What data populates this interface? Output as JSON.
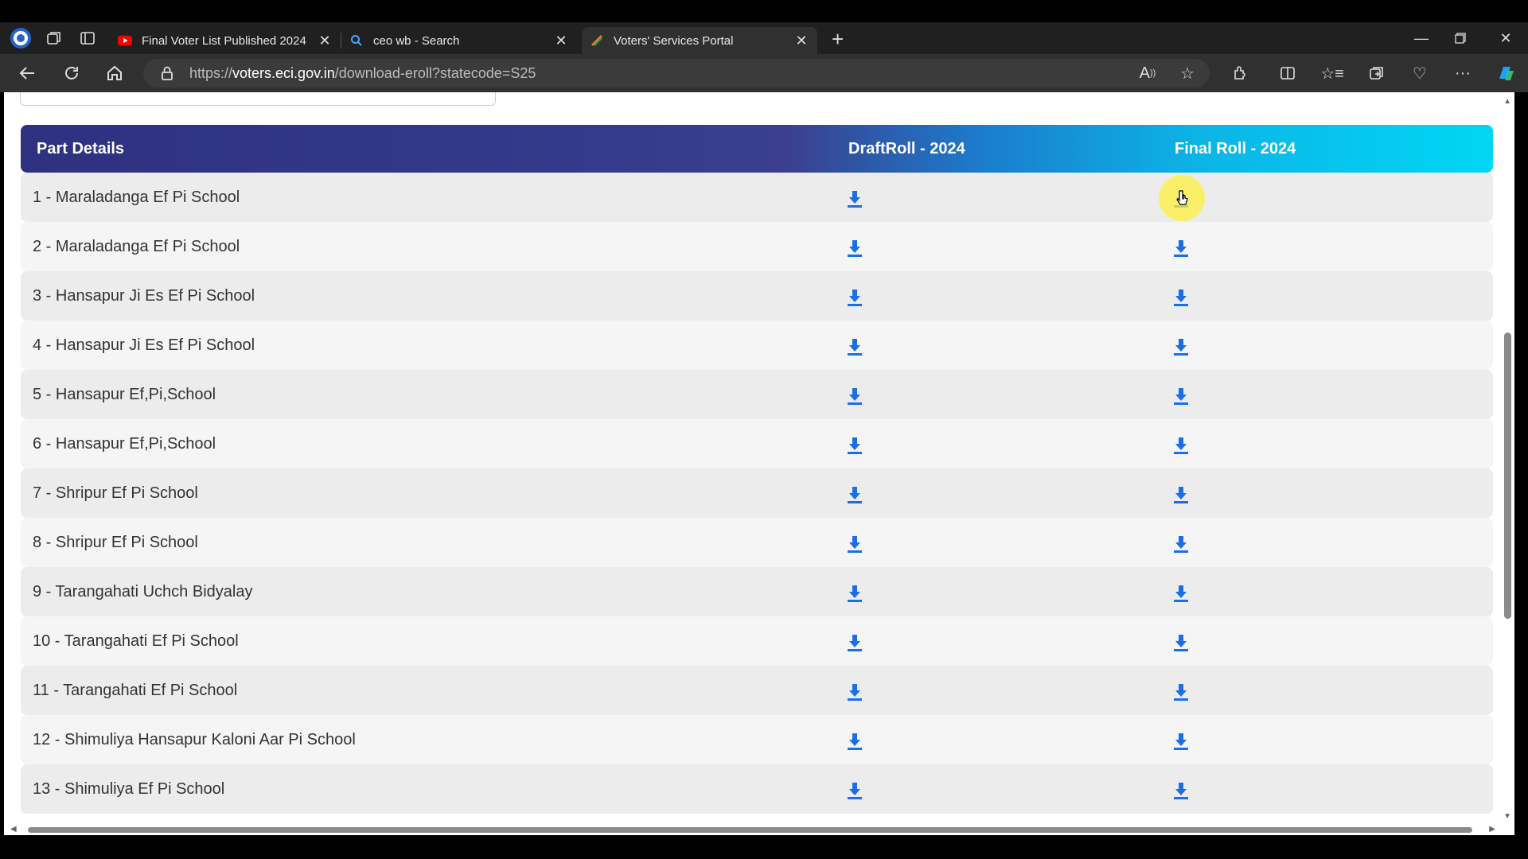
{
  "browser": {
    "tabs": [
      {
        "title": "Final Voter List Published 2024 ||",
        "favicon": "youtube-icon",
        "active": false
      },
      {
        "title": "ceo wb - Search",
        "favicon": "search-icon",
        "active": false
      },
      {
        "title": "Voters' Services Portal",
        "favicon": "eci-icon",
        "active": true
      }
    ],
    "url_prefix": "https://",
    "url_host": "voters.eci.gov.in",
    "url_path": "/download-eroll?statecode=S25"
  },
  "table": {
    "headers": {
      "part": "Part Details",
      "draft": "DraftRoll - 2024",
      "final": "Final Roll - 2024"
    },
    "rows": [
      "1 - Maraladanga Ef Pi School",
      "2 - Maraladanga Ef Pi School",
      "3 - Hansapur Ji Es Ef Pi School",
      "4 - Hansapur Ji Es Ef Pi School",
      "5 - Hansapur Ef,Pi,School",
      "6 - Hansapur Ef,Pi,School",
      "7 - Shripur Ef Pi School",
      "8 - Shripur Ef Pi School",
      "9 - Tarangahati Uchch Bidyalay",
      "10 - Tarangahati Ef Pi School",
      "11 - Tarangahati Ef Pi School",
      "12 - Shimuliya Hansapur Kaloni Aar Pi School",
      "13 - Shimuliya Ef Pi School"
    ]
  },
  "colors": {
    "download_icon": "#1a6ee8",
    "header_start": "#2e3180",
    "header_end": "#00d7f4"
  }
}
